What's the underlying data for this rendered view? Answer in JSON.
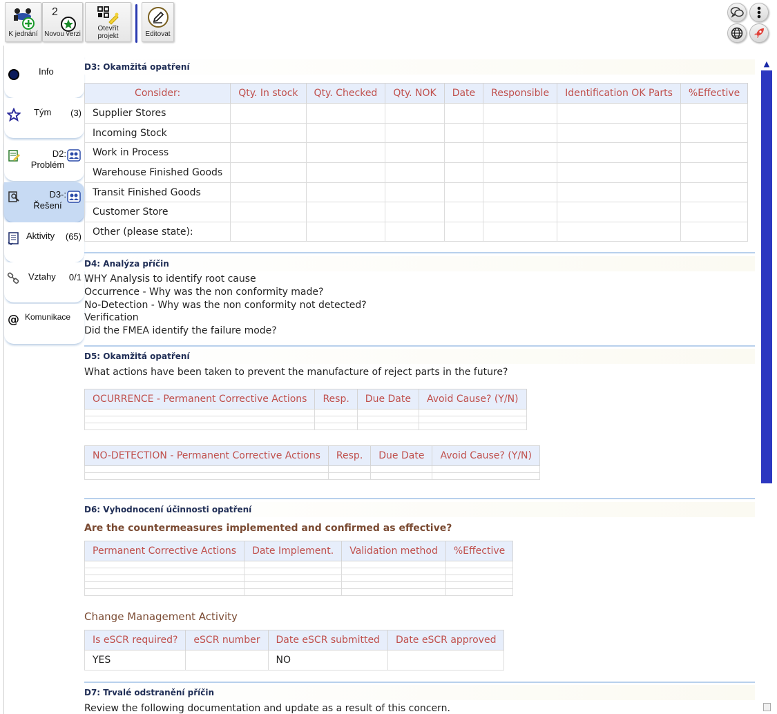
{
  "toolbar": {
    "k_jednani": "K jednání",
    "nova_verze_count": "2",
    "nova_verze": "Novou verzi",
    "otevrit_line1": "Otevřít",
    "otevrit_line2": "projekt",
    "editovat": "Editovat"
  },
  "sidebar": {
    "info": "Info",
    "tym": "Tým",
    "tym_count": "(3)",
    "d2_line1": "D2:",
    "d2_line2": "Problém",
    "d3_line1": "D3-:",
    "d3_line2": "Řešení",
    "aktivity": "Aktivity",
    "aktivity_count": "(65)",
    "vztahy": "Vztahy",
    "vztahy_count": "0/1",
    "komunikace": "Komunikace"
  },
  "d3": {
    "title": "D3: Okamžitá opatření",
    "headers": [
      "Consider:",
      "Qty. In stock",
      "Qty. Checked",
      "Qty. NOK",
      "Date",
      "Responsible",
      "Identification OK Parts",
      "%Effective"
    ],
    "rows": [
      "Supplier Stores",
      "Incoming Stock",
      "Work in Process",
      "Warehouse Finished Goods",
      "Transit Finished Goods",
      "Customer Store",
      "Other (please state):"
    ]
  },
  "d4": {
    "title": "D4: Analýza příčin",
    "lines": [
      "WHY Analysis to identify root cause",
      "Occurrence - Why was the non conformity made?",
      "No-Detection - Why was the non conformity not detected?",
      "Verification",
      "Did the FMEA identify the failure mode?"
    ]
  },
  "d5": {
    "title": "D5: Okamžitá opatření",
    "question": "What actions have been taken to prevent the manufacture of reject parts in the future?",
    "occ_headers": [
      "OCURRENCE - Permanent Corrective Actions",
      "Resp.",
      "Due Date",
      "Avoid Cause? (Y/N)"
    ],
    "det_headers": [
      "NO-DETECTION - Permanent Corrective Actions",
      "Resp.",
      "Due Date",
      "Avoid Cause? (Y/N)"
    ]
  },
  "d6": {
    "title": "D6: Vyhodnocení účinnosti opatření",
    "question": "Are the countermeasures implemented and confirmed as effective?",
    "headers": [
      "Permanent Corrective Actions",
      "Date Implement.",
      "Validation method",
      "%Effective"
    ],
    "change_title": "Change Management Activity",
    "cm_headers": [
      "Is eSCR required?",
      "eSCR number",
      "Date eSCR submitted",
      "Date eSCR approved"
    ],
    "cm_values": [
      "YES",
      "",
      "NO",
      ""
    ]
  },
  "d7": {
    "title": "D7: Trvalé odstranění příčin",
    "text": "Review the following documentation and update as a result of this concern."
  },
  "colors": {
    "header_text": "#c0504d",
    "header_bg": "#e7eefb",
    "scroll_thumb": "#2c37c0",
    "section_title": "#1f2d55"
  }
}
